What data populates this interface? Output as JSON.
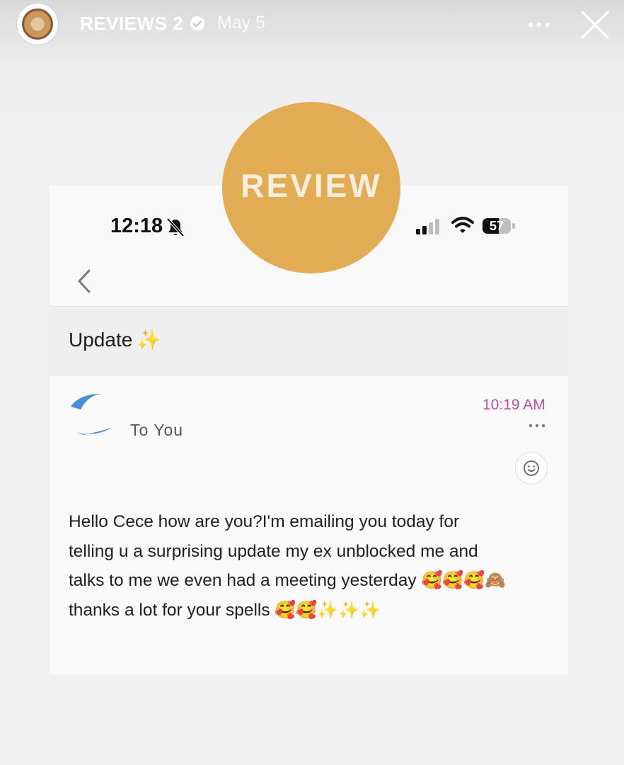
{
  "story": {
    "account_name": "REVIEWS 2",
    "date": "May 5",
    "more_icon": "more-horizontal-icon",
    "close_icon": "close-icon"
  },
  "badge": {
    "text": "REVIEW",
    "color": "#e2ac55"
  },
  "phone_status": {
    "time": "12:18",
    "battery": "57"
  },
  "email": {
    "subject": "Update",
    "subject_emoji": "✨",
    "recipient": "To You",
    "time": "10:19 AM",
    "time_color": "#b84fb2",
    "body_lines": [
      "Hello Cece how are you?I'm emailing you today for",
      "telling u a surprising update my ex unblocked me and",
      "talks to me we even had a meeting yesterday",
      "thanks a lot for your spells"
    ],
    "line3_emojis": "🥰🥰🥰🙈",
    "line4_emojis": "🥰🥰",
    "line4_sparkles": "✨✨✨"
  }
}
